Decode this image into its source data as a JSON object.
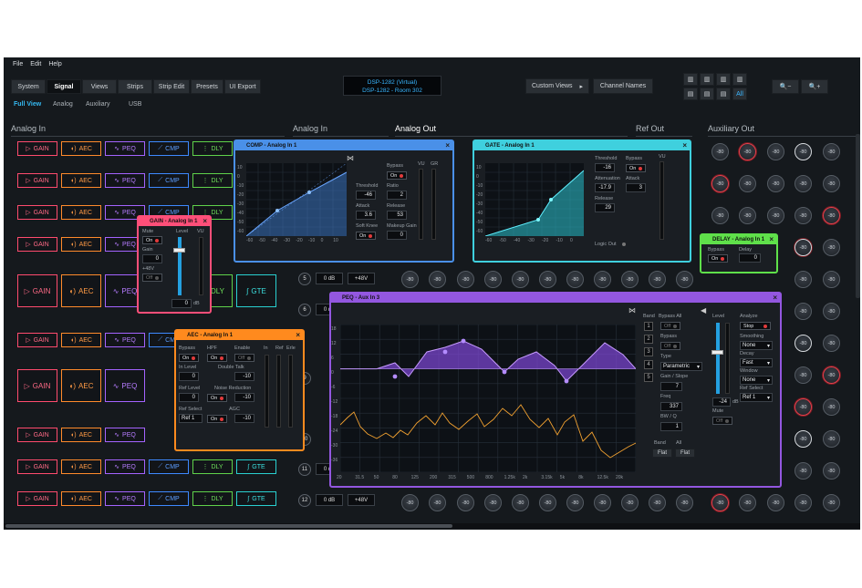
{
  "menu": [
    "File",
    "Edit",
    "Help"
  ],
  "tabs": [
    "System",
    "Signal",
    "Views",
    "Strips",
    "Strip Edit",
    "Presets",
    "UI Export"
  ],
  "subtabs": [
    "Full View",
    "Analog",
    "Auxiliary",
    "USB"
  ],
  "device": {
    "line1": "DSP-1282 (Virtual)",
    "line2": "DSP-1282 - Room 302"
  },
  "toolbar": {
    "custom_views": "Custom Views",
    "channel_names": "Channel Names",
    "all": "All"
  },
  "sections": {
    "analog_in_1": "Analog In",
    "analog_in_2": "Analog In",
    "analog_out": "Analog Out",
    "ref_out": "Ref Out",
    "aux_out": "Auxiliary Out"
  },
  "strip_labels": {
    "gain": "GAIN",
    "aec": "AEC",
    "peq": "PEQ",
    "cmp": "CMP",
    "dly": "DLY",
    "gte": "GTE"
  },
  "channel_rows": [
    {
      "num": "5",
      "db": "0 dB",
      "phantom": "+48V"
    },
    {
      "num": "6",
      "db": "0 dB",
      "phantom": "+48V"
    },
    {
      "num": "11",
      "db": "0 dB",
      "phantom": "+48V"
    },
    {
      "num": "12",
      "db": "0 dB",
      "phantom": "+48V"
    }
  ],
  "knob_vals": {
    "a": "-80",
    "b": "-80",
    "c": "-80",
    "d": "15",
    "e": "-62",
    "f": "17",
    "g": "-6"
  },
  "comp": {
    "title": "COMP - Analog In 1",
    "threshold_label": "Threshold",
    "threshold": "-46",
    "ratio_label": "Ratio",
    "ratio": "2",
    "attack_label": "Attack",
    "attack": "3.6",
    "release_label": "Release",
    "release": "53",
    "softknee_label": "Soft Knee",
    "softknee": "On",
    "makeup_label": "Makeup Gain",
    "makeup": "0",
    "bypass_label": "Bypass",
    "bypass": "On",
    "vu": "VU",
    "gr": "GR",
    "xticks": [
      "-60",
      "-50",
      "-40",
      "-30",
      "-20",
      "-10",
      "0",
      "10"
    ],
    "yticks": [
      "10",
      "0",
      "-10",
      "-20",
      "-30",
      "-40",
      "-50",
      "-60"
    ]
  },
  "gate": {
    "title": "GATE - Analog In 1",
    "threshold_label": "Threshold",
    "threshold": "-16",
    "atten_label": "Attenuation",
    "atten": "-17.9",
    "attack_label": "Attack",
    "attack": "3",
    "release_label": "Release",
    "release": "29",
    "bypass_label": "Bypass",
    "bypass": "On",
    "vu": "VU",
    "logic": "Logic Out",
    "xticks": [
      "-60",
      "-50",
      "-40",
      "-30",
      "-20",
      "-10",
      "0"
    ],
    "yticks": [
      "10",
      "0",
      "-10",
      "-20",
      "-30",
      "-40",
      "-50",
      "-60"
    ]
  },
  "gain": {
    "title": "GAIN - Analog In 1",
    "mute_label": "Mute",
    "mute": "On",
    "gain_label": "Gain",
    "gain": "0",
    "p48_label": "+48V",
    "p48": "Off",
    "level_label": "Level",
    "vu": "VU",
    "level": "0",
    "unit": "dB"
  },
  "aec": {
    "title": "AEC - Analog In 1",
    "bypass_label": "Bypass",
    "bypass": "On",
    "hpf_label": "HPF",
    "hpf": "On",
    "enable_label": "Enable",
    "enable": "Off",
    "inlevel_label": "In Level",
    "inlevel": "0",
    "dt_label": "Double Talk",
    "dt": "-10",
    "ref_label": "Ref Level",
    "ref": "0",
    "nr_label": "Noise Reduction",
    "nr": "-10",
    "refsel_label": "Ref Select",
    "refsel": "Ref 1",
    "agc_label": "AGC",
    "agc": "-10",
    "in": "In",
    "reflbl": "Ref",
    "erle": "Erle"
  },
  "delay": {
    "title": "DELAY - Analog In 1",
    "bypass_label": "Bypass",
    "bypass": "On",
    "delay_label": "Delay",
    "delay": "0"
  },
  "peq": {
    "title": "PEQ - Aux In 3",
    "bands": [
      "1",
      "2",
      "3",
      "4",
      "5"
    ],
    "bypass_all_label": "Bypass All",
    "bypass_all": "Off",
    "bypass_label": "Bypass",
    "bypass": "Off",
    "type_label": "Type",
    "type": "Parametric",
    "gainslope_label": "Gain / Slope",
    "gainslope": "7",
    "freq_label": "Freq",
    "freq": "337",
    "bwq_label": "BW / Q",
    "bwq": "1",
    "band_label": "Band",
    "all_label": "All",
    "flat": "Flat",
    "level_label": "Level",
    "level": "-24",
    "unit": "dB",
    "mute_label": "Mute",
    "mute": "Off",
    "analyze_label": "Analyze",
    "analyze": "Stop",
    "smoothing_label": "Smoothing",
    "smoothing": "None",
    "decay_label": "Decay",
    "decay": "Fast",
    "window_label": "Window",
    "window": "None",
    "refsel_label": "Ref Select",
    "refsel": "Ref 1",
    "yticks": [
      "18",
      "12",
      "6",
      "0",
      "-6",
      "-12",
      "-18",
      "-24",
      "-30",
      "-36"
    ],
    "xticks": [
      "20",
      "31.5",
      "50",
      "80",
      "125",
      "200",
      "315",
      "500",
      "800",
      "1.25k",
      "2k",
      "3.15k",
      "5k",
      "8k",
      "12.5k",
      "20k"
    ]
  },
  "colors": {
    "comp": "#4a90e8",
    "gate": "#3fd0de",
    "gain": "#ff4f79",
    "aec": "#ff8a1e",
    "delay": "#5fe04a",
    "peq": "#9357e0"
  }
}
